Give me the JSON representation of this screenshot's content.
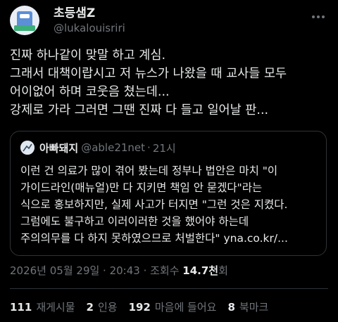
{
  "author": {
    "display_name": "초등샘Z",
    "handle": "@lukalouisriri",
    "avatar_icon": "profile-avatar-image"
  },
  "more_icon": "more-options-icon",
  "tweet_lines": [
    "진짜 하나같이 맞말 하고 계심.",
    "그래서 대책이랍시고 저 뉴스가 나왔을 때 교사들 모두",
    "어이없어 하며 코웃음 쳤는데...",
    "강제로 가라 그러면 그땐 진짜 다 들고 일어날 판..."
  ],
  "quote": {
    "display_name": "아빠돼지",
    "handle": "@able21net",
    "separator": "·",
    "time": "21시",
    "avatar_icon": "quoted-avatar-image",
    "lines": [
      "이런 건 의료가 많이 겪어 봤는데 정부나 법안은 마치 \"이",
      "가이드라인(매뉴얼)만 다 지키면 책임 안 묻겠다\"라는",
      "식으로 홍보하지만, 실제 사고가 터지면 \"그런 것은 지켰다.",
      "그럼에도 불구하고 이러이러한 것을 했어야 하는데",
      "주의의무를 다 하지 못하였으므로 처벌한다\" yna.co.kr/..."
    ]
  },
  "meta": {
    "timestamp": "2026년 05월 29일 · 20:43 · 조회수 ",
    "views": "14.7천",
    "views_suffix": "회"
  },
  "stats": [
    {
      "num": "111",
      "label": "재게시물"
    },
    {
      "num": "2",
      "label": "인용"
    },
    {
      "num": "192",
      "label": "마음에 들어요"
    },
    {
      "num": "8",
      "label": "북마크"
    }
  ],
  "colors": {
    "background": "#000000",
    "text": "#e7e9ea",
    "secondary": "#71767b",
    "border": "#2f3336"
  }
}
